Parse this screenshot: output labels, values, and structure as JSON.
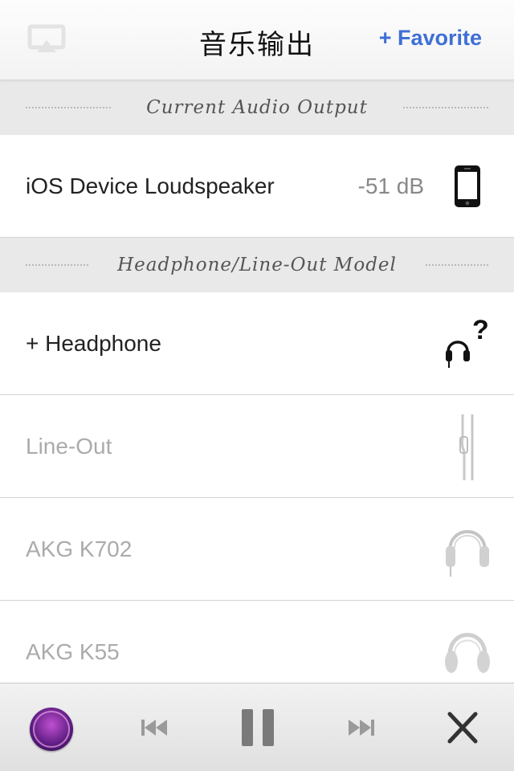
{
  "nav": {
    "title": "音乐输出",
    "favorite_label": "+ Favorite",
    "airplay_icon": "airplay-icon"
  },
  "sections": {
    "current": {
      "title": "Current Audio Output"
    },
    "model": {
      "title": "Headphone/Line-Out Model"
    }
  },
  "current_output": {
    "label": "iOS Device Loudspeaker",
    "level": "-51 dB",
    "icon": "phone-icon"
  },
  "models": [
    {
      "label": "+ Headphone",
      "icon": "headphone-question-icon",
      "dimmed": false
    },
    {
      "label": "Line-Out",
      "icon": "line-out-cable-icon",
      "dimmed": true
    },
    {
      "label": "AKG K702",
      "icon": "headphone-icon",
      "dimmed": true
    },
    {
      "label": "AKG K55",
      "icon": "headphone-icon",
      "dimmed": true
    }
  ],
  "player": {
    "album_art": "album-art",
    "prev_icon": "previous-track-icon",
    "pause_icon": "pause-icon",
    "next_icon": "next-track-icon",
    "close_icon": "close-icon"
  },
  "colors": {
    "accent": "#3e6fd6",
    "section_bg": "#e9e9e9",
    "dim_text": "#ababab"
  }
}
